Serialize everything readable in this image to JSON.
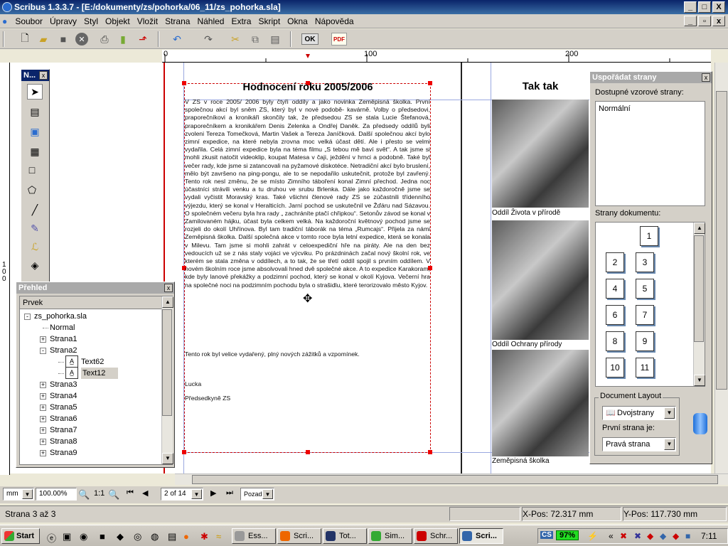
{
  "window": {
    "title": "Scribus 1.3.3.7 - [E:/dokumenty/zs/pohorka/06_11/zs_pohorka.sla]",
    "minimize": "_",
    "maximize": "□",
    "close": "X"
  },
  "menu": [
    "Soubor",
    "Úpravy",
    "Styl",
    "Objekt",
    "Vložit",
    "Strana",
    "Náhled",
    "Extra",
    "Skript",
    "Okna",
    "Nápověda"
  ],
  "toolbar": {
    "ok_label": "OK",
    "pdf_label": "PDF"
  },
  "ruler": {
    "ticks": [
      "0",
      "100",
      "200"
    ],
    "v_label": "100"
  },
  "article": {
    "heading": "Hodnocení roku 2005/2006",
    "paragraphs": [
      "V ZS v roce 2005/ 2006 byly čtyři oddíly a jako novinka Zeměpisná školka. První společnou akcí byl sněm ZS, který byl v nové podobě- kavárně. Volby o předsedovi, praporečníkovi a kronikáři skončily tak, že předsedou ZS se stala Lucie Štefanová, praporečníkem a kronikářem Denis Zelenka a Ondřej Daněk. Za předsedy oddílů byli zvoleni Tereza Tomečková, Martin Vašek a Tereza Janíčková. Další společnou akcí bylo zimní expedice, na které nebyla zrovna moc velká účast dětí. Ale i přesto se velmi vydařila. Celá zimní expedice byla na téma filmu „S tebou mě baví svět“. A tak jsme si mohli zkusit natočit videoklip, koupat Matesa v čaji, ježdění v hrnci a podobně. Také byl večer rady, kde jsme si zatancovali na pyžamové diskotéce. Netradiční akcí bylo bruslení, mělo být završeno na ping-pongu, ale to se nepodařilo uskutečnit, protože byl zavřený. Tento rok nesl změnu, že se místo Zimního táboření konal Zimní přechod. Jedna noc účastníci strávili venku a tu druhou ve srubu Brlenka. Dále jako každoročně jsme se vydali vyčistit Moravský kras. Také všichni členové rady ZS se zúčastnili třídenního výjezdu, který se konal v Heralticích. Jarní pochod se uskutečnil ve Žďáru nad Sázavou. O společném večeru byla hra rady „ zachráníte ptačí chřipkou“. Setonův závod se konal v Zamilovaném hájku, účast byla celkem velká. Na každoroční květnový pochod jsme se rozjeli do okolí Uhřínova. Byl tam tradiční táborák na téma „Rumcajs“. Přijela za námi Zeměpisná školka. Další společná akce v tomto roce byla letní expedice, která se konala v Milevu. Tam jsme si mohli zahrát v celoexpediční hře na piráty. Ale na den bez vedoucích už se z nás staly vojáci ve výcviku. Po prázdninách začal nový školní rok, ve kterém se stala změna v oddílech, a to tak, že se třetí oddíl spojil s prvním oddílem. V novém školním roce jsme absolvovali hned dvě společné akce. A to expedice Karakoram, kde byly lanové překážky a podzimní pochod, který se konal v okolí Kyjova. Večerní hra na společné noci na podzimním pochodu byla o strašidlu, které terorizovalo město Kyjov.",
      "Tento rok byl velice vydařený, plný nových zážitků a vzpomínek.",
      "Lucka",
      "Předsedkyně ZS"
    ]
  },
  "right_page": {
    "heading": "Tak tak",
    "captions": [
      "Oddíl Života v přírodě",
      "Oddíl Ochrany přírody",
      "Zeměpisná školka"
    ]
  },
  "tools_palette": {
    "title": "N..."
  },
  "outline": {
    "title": "Přehled",
    "header": "Prvek",
    "items": [
      {
        "label": "zs_pohorka.sla",
        "level": 0,
        "exp": "-"
      },
      {
        "label": "Normal",
        "level": 1,
        "exp": ""
      },
      {
        "label": "Strana1",
        "level": 1,
        "exp": "+"
      },
      {
        "label": "Strana2",
        "level": 1,
        "exp": "-"
      },
      {
        "label": "Text62",
        "level": 2,
        "exp": "",
        "icon": true
      },
      {
        "label": "Text12",
        "level": 2,
        "exp": "",
        "icon": true,
        "selected": true
      },
      {
        "label": "Strana3",
        "level": 1,
        "exp": "+"
      },
      {
        "label": "Strana4",
        "level": 1,
        "exp": "+"
      },
      {
        "label": "Strana5",
        "level": 1,
        "exp": "+"
      },
      {
        "label": "Strana6",
        "level": 1,
        "exp": "+"
      },
      {
        "label": "Strana7",
        "level": 1,
        "exp": "+"
      },
      {
        "label": "Strana8",
        "level": 1,
        "exp": "+"
      },
      {
        "label": "Strana9",
        "level": 1,
        "exp": "+"
      }
    ]
  },
  "arrange": {
    "title": "Uspořádat strany",
    "templates_label": "Dostupné vzorové strany:",
    "templates": [
      "Normální"
    ],
    "doc_pages_label": "Strany dokumentu:",
    "pages": [
      "1",
      "2",
      "3",
      "4",
      "5",
      "6",
      "7",
      "8",
      "9",
      "10",
      "11"
    ],
    "layout_group": "Document Layout",
    "layout_value": "Dvojstrany",
    "first_page_label": "První strana je:",
    "first_page_value": "Pravá strana"
  },
  "bottom_bar": {
    "unit": "mm",
    "zoom": "100.00%",
    "ratio": "1:1",
    "page": "2 of 14",
    "layer": "Pozadí"
  },
  "status": {
    "text": "Strana 3 až 3",
    "xpos_label": "X-Pos:",
    "xpos": "72.317 mm",
    "ypos_label": "Y-Pos:",
    "ypos": "117.730 mm"
  },
  "taskbar": {
    "start": "Start",
    "tasks": [
      "Ess...",
      "Scri...",
      "Tot...",
      "Sim...",
      "Schr...",
      "Scri..."
    ],
    "battery": "97%",
    "clock": "7:11"
  }
}
